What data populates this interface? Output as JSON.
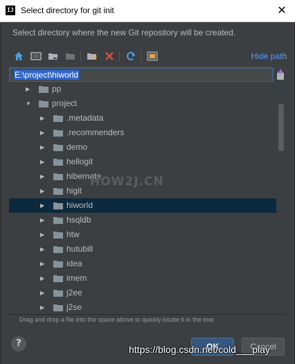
{
  "window": {
    "app_icon": "IJ",
    "title": "Select directory for git init",
    "close_label": "✕"
  },
  "description": "Select directory where the new Git repository will be created.",
  "toolbar": {
    "icons": [
      "home-icon",
      "desktop-icon",
      "project-folder-icon",
      "module-folder-icon",
      "new-folder-icon",
      "delete-icon",
      "refresh-icon",
      "show-hidden-icon"
    ],
    "hide_path_label": "Hide path"
  },
  "path_input": {
    "value": "E:\\project\\hiworld"
  },
  "tree": {
    "items": [
      {
        "label": "pp",
        "expanded": false,
        "depth": 1,
        "selected": false
      },
      {
        "label": "project",
        "expanded": true,
        "depth": 1,
        "selected": false
      },
      {
        "label": ".metadata",
        "expanded": false,
        "depth": 2,
        "selected": false
      },
      {
        "label": ".recommenders",
        "expanded": false,
        "depth": 2,
        "selected": false
      },
      {
        "label": "demo",
        "expanded": false,
        "depth": 2,
        "selected": false
      },
      {
        "label": "hellogit",
        "expanded": false,
        "depth": 2,
        "selected": false
      },
      {
        "label": "hibernate",
        "expanded": false,
        "depth": 2,
        "selected": false
      },
      {
        "label": "higit",
        "expanded": false,
        "depth": 2,
        "selected": false
      },
      {
        "label": "hiworld",
        "expanded": false,
        "depth": 2,
        "selected": true
      },
      {
        "label": "hsqldb",
        "expanded": false,
        "depth": 2,
        "selected": false
      },
      {
        "label": "htw",
        "expanded": false,
        "depth": 2,
        "selected": false
      },
      {
        "label": "hutubill",
        "expanded": false,
        "depth": 2,
        "selected": false
      },
      {
        "label": "idea",
        "expanded": false,
        "depth": 2,
        "selected": false
      },
      {
        "label": "imem",
        "expanded": false,
        "depth": 2,
        "selected": false
      },
      {
        "label": "j2ee",
        "expanded": false,
        "depth": 2,
        "selected": false
      },
      {
        "label": "j2se",
        "expanded": false,
        "depth": 2,
        "selected": false
      }
    ]
  },
  "hint": "Drag and drop a file into the space above to quickly locate it in the tree",
  "buttons": {
    "help": "?",
    "ok": "OK",
    "cancel": "Cancel"
  },
  "watermark": "HOW2J.CN",
  "url_overlay": "https://blog.csdn.net/cold___play",
  "colors": {
    "background": "#3c3f41",
    "selected_row": "#0d293e",
    "link": "#589df6",
    "ok_button": "#365880",
    "folder": "#87939a"
  }
}
